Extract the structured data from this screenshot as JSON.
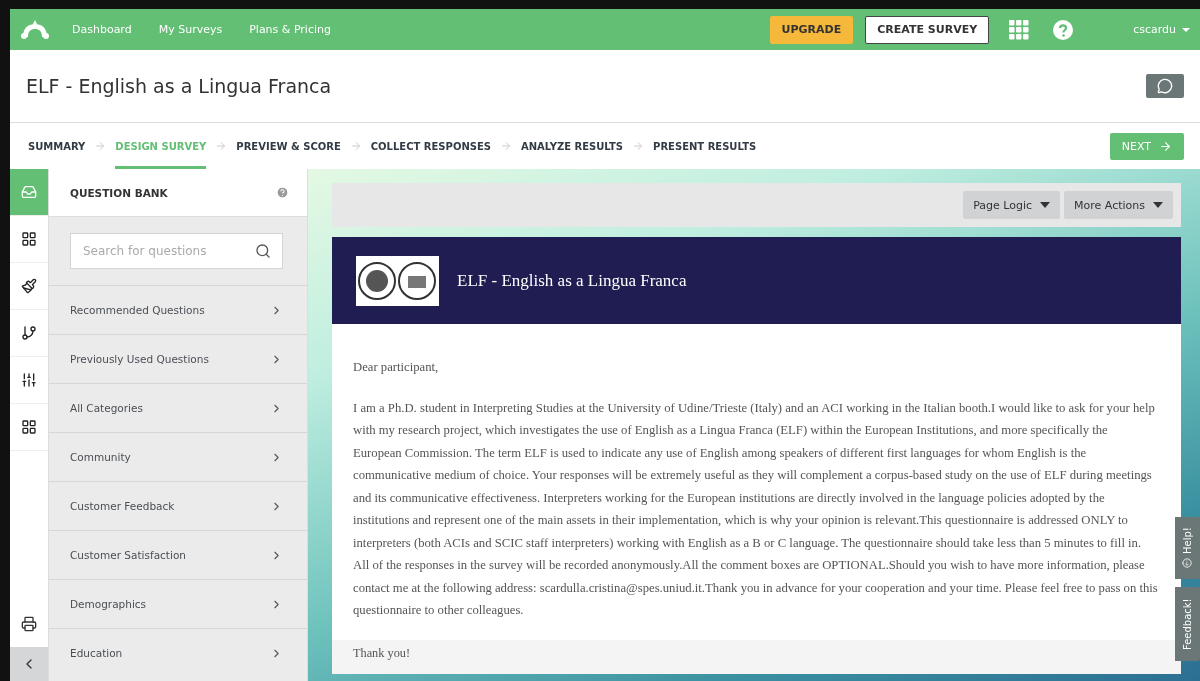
{
  "topbar": {
    "nav": [
      "Dashboard",
      "My Surveys",
      "Plans & Pricing"
    ],
    "upgrade": "UPGRADE",
    "create": "CREATE SURVEY",
    "user": "cscardu"
  },
  "survey_title": "ELF - English as a Lingua Franca",
  "steps": [
    {
      "label": "SUMMARY",
      "selected": false
    },
    {
      "label": "DESIGN SURVEY",
      "selected": true
    },
    {
      "label": "PREVIEW & SCORE",
      "selected": false
    },
    {
      "label": "COLLECT RESPONSES",
      "selected": false
    },
    {
      "label": "ANALYZE RESULTS",
      "selected": false
    },
    {
      "label": "PRESENT RESULTS",
      "selected": false
    }
  ],
  "next_button": "NEXT",
  "rail": [
    {
      "kind": "bank",
      "selected": true
    },
    {
      "kind": "builder",
      "selected": false
    },
    {
      "kind": "style",
      "selected": false
    },
    {
      "kind": "logic",
      "selected": false
    },
    {
      "kind": "options",
      "selected": false
    },
    {
      "kind": "library",
      "selected": false
    }
  ],
  "question_bank": {
    "title": "QUESTION BANK",
    "search": {
      "placeholder": "Search for questions"
    },
    "items": [
      "Recommended Questions",
      "Previously Used Questions",
      "All Categories",
      "Community",
      "Customer Feedback",
      "Customer Satisfaction",
      "Demographics",
      "Education"
    ]
  },
  "toolbar": [
    "Page Logic",
    "More Actions"
  ],
  "survey": {
    "header": "ELF - English as a Lingua Franca",
    "greeting": "Dear participant,",
    "body": "I am a Ph.D. student in Interpreting Studies at the University of Udine/Trieste (Italy) and an ACI working in the Italian booth.I would like to ask for your help with my research project, which investigates the use of English as a Lingua Franca (ELF) within the European Institutions, and more specifically the European Commission. The term ELF is used to indicate any use of English among speakers of different first languages for whom English is the communicative medium of choice. Your responses will be extremely useful as they will complement a corpus-based study on the use of ELF during meetings and its communicative effectiveness. Interpreters working for the European institutions are directly involved in the language policies adopted by the institutions and represent one of the main assets in their implementation, which is why your opinion is relevant.This questionnaire is addressed ONLY to interpreters (both ACIs and SCIC staff interpreters) working with English as a B or C language. The questionnaire should take less than 5 minutes to fill in. All of the responses in the survey will be recorded anonymously.All the comment boxes are OPTIONAL.Should you wish to have more information, please contact me at the following address: scardulla.cristina@spes.uniud.it.Thank you in advance for your cooperation and your time. Please feel free to pass on this questionnaire to other colleagues.",
    "thanks": "Thank you!"
  },
  "side_tabs": [
    "Help!",
    "Feedback!"
  ]
}
